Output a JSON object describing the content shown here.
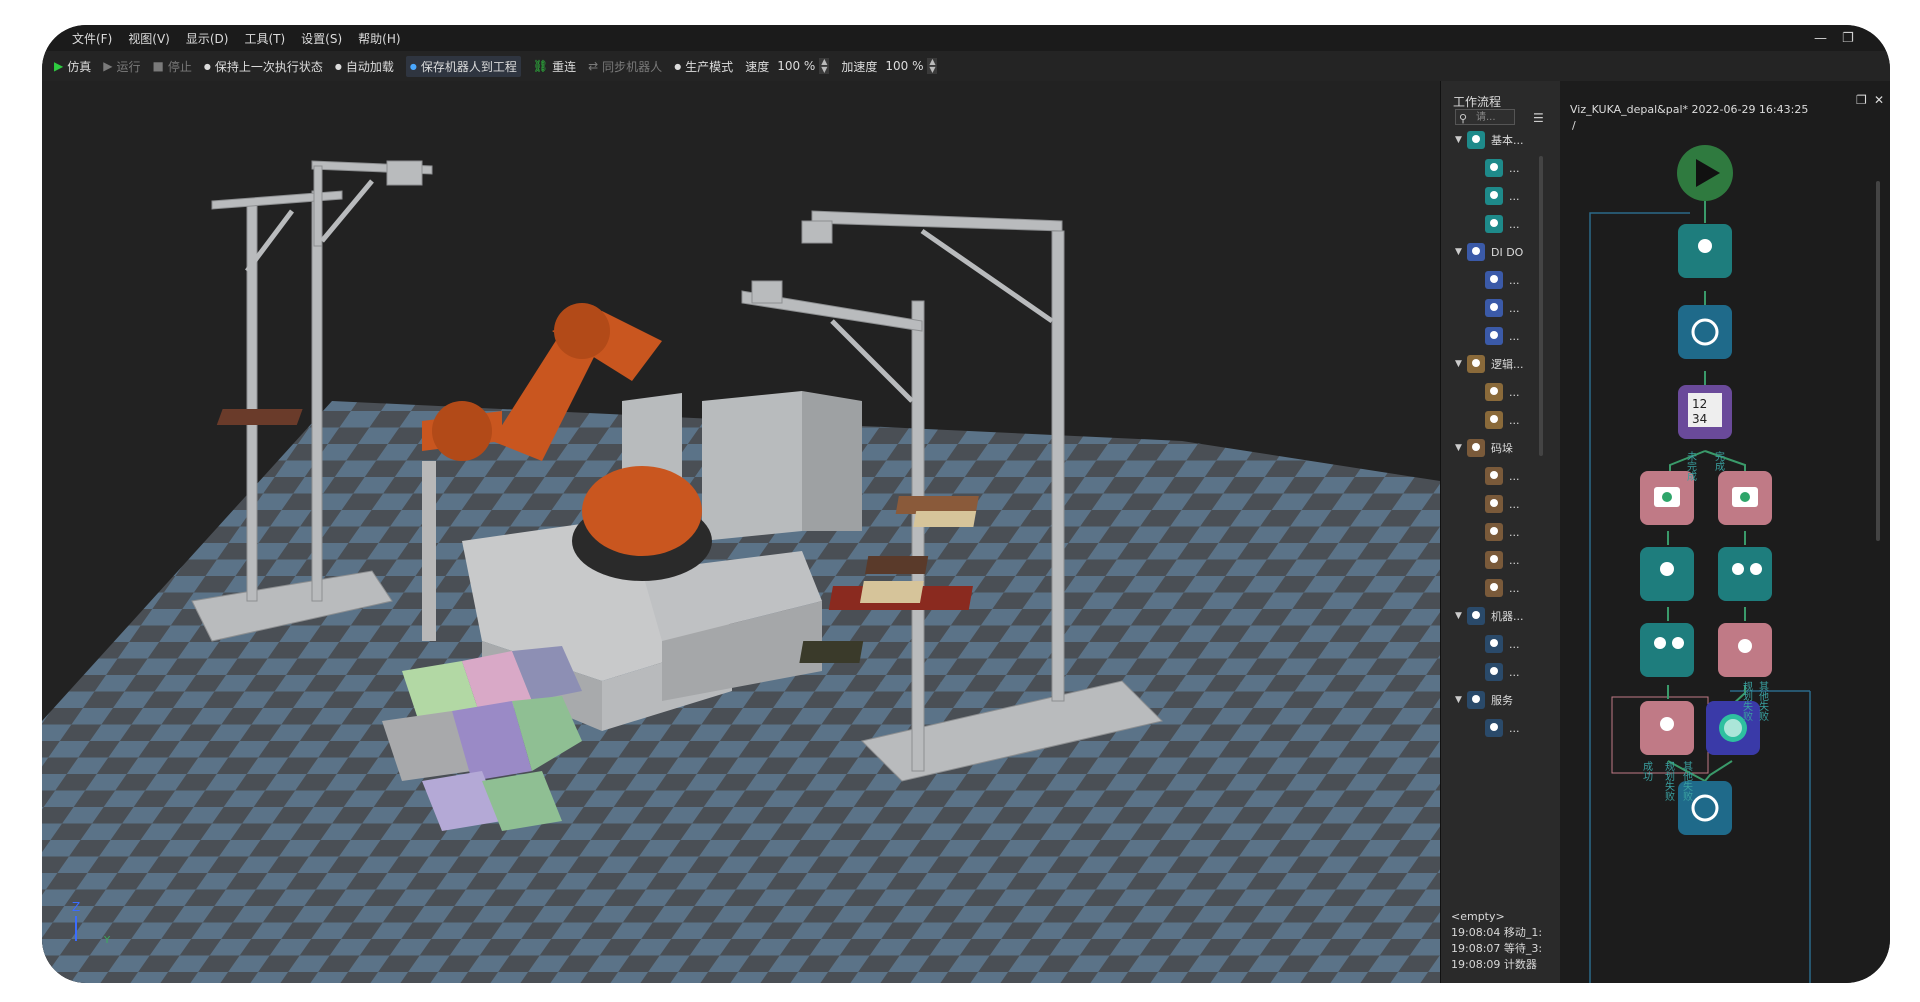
{
  "menu": {
    "items": [
      "文件(F)",
      "视图(V)",
      "显示(D)",
      "工具(T)",
      "设置(S)",
      "帮助(H)"
    ]
  },
  "window_controls": {
    "minimize": "—",
    "restore": "❐",
    "close": "✕"
  },
  "toolbar": {
    "simulate": "仿真",
    "run": "运行",
    "stop": "停止",
    "keep_state": "保持上一次执行状态",
    "auto_load": "自动加载",
    "save_robot": "保存机器人到工程",
    "reconnect": "重连",
    "sync_robot": "同步机器人",
    "production_mode": "生产模式",
    "speed_label": "速度",
    "speed_value": "100 %",
    "accel_label": "加速度",
    "accel_value": "100 %"
  },
  "workflow_panel": {
    "title": "工作流程",
    "search_placeholder": "请...",
    "groups": [
      {
        "label": "基本...",
        "color": "#1e8a8a",
        "children": [
          "...",
          "...",
          "..."
        ]
      },
      {
        "label": "DI DO",
        "color": "#3b5aa8",
        "children": [
          "...",
          "...",
          "..."
        ]
      },
      {
        "label": "逻辑...",
        "color": "#8a6a3a",
        "children": [
          "...",
          "..."
        ]
      },
      {
        "label": "码垛",
        "color": "#7a5a3a",
        "children": [
          "...",
          "...",
          "...",
          "...",
          "..."
        ]
      },
      {
        "label": "机器...",
        "color": "#2a4a6a",
        "children": [
          "...",
          "..."
        ]
      },
      {
        "label": "服务",
        "color": "#2a4a6a",
        "children": [
          "..."
        ]
      }
    ],
    "log": [
      "<empty>",
      "19:08:04 移动_1:",
      "19:08:07 等待_3:",
      "19:08:09 计数器"
    ]
  },
  "flow_editor": {
    "title": "Viz_KUKA_depal&pal* 2022-06-29 16:43:25",
    "path": "/",
    "branch_labels": {
      "counter_left": "未完成",
      "counter_right": "完成",
      "left_success": "成功",
      "left_plan_fail": "规划失败",
      "left_other_fail": "其他失败",
      "right_plan_fail": "规划失败",
      "right_other_fail": "其他失败"
    }
  },
  "viewport": {
    "axis_z": "Z",
    "axis_y": "Y"
  },
  "colors": {
    "teal_node": "#1e7d7d",
    "blue_node": "#1f6a8a",
    "purple_node": "#6a4a9a",
    "pink_node": "#c07a86",
    "robot_orange": "#c9561f",
    "floor_dark": "#4a4f55",
    "floor_light": "#5b7388"
  }
}
